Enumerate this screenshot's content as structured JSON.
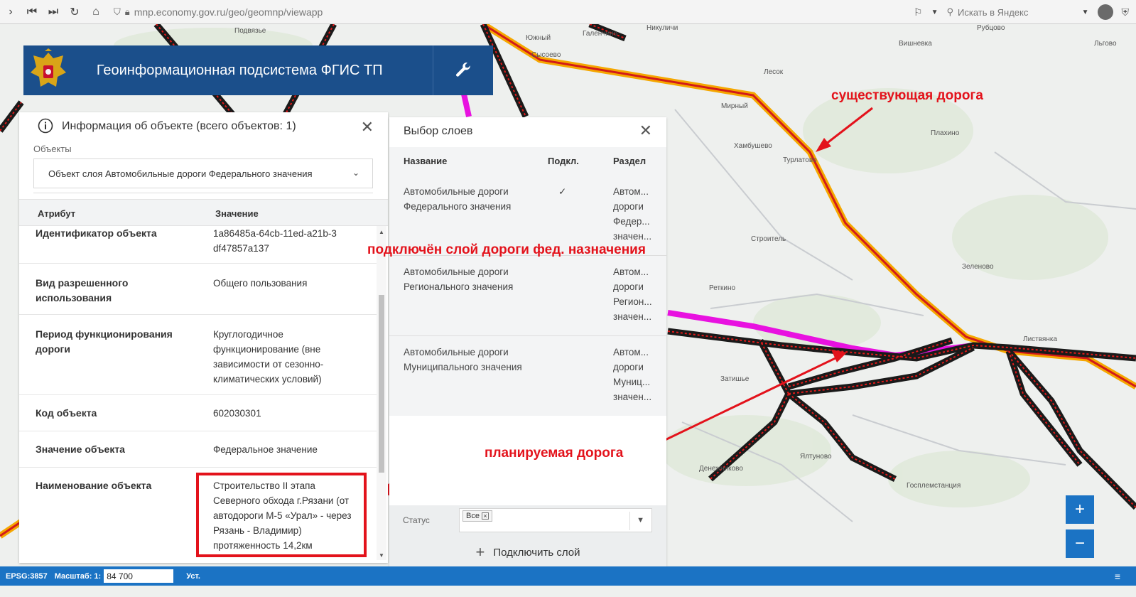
{
  "browser": {
    "url": "mnp.economy.gov.ru/geo/geomnp/viewapp",
    "search_placeholder": "Искать в Яндекс"
  },
  "header": {
    "title": "Геоинформационная подсистема ФГИС ТП"
  },
  "info_panel": {
    "title": "Информация об объекте (всего объектов: 1)",
    "objects_label": "Объекты",
    "selected_object": "Объект слоя Автомобильные дороги Федерального значения",
    "columns": [
      "Атрибут",
      "Значение"
    ],
    "rows": [
      {
        "attr": "Идентификатор объекта",
        "value": "1a86485a-64cb-11ed-a21b-3df47857a137"
      },
      {
        "attr": "Вид разрешенного использования",
        "value": "Общего пользования"
      },
      {
        "attr": "Период функционирования дороги",
        "value": "Круглогодичное функционирование (вне зависимости от сезонно-климатических условий)"
      },
      {
        "attr": "Код объекта",
        "value": "602030301"
      },
      {
        "attr": "Значение объекта",
        "value": "Федеральное значение"
      },
      {
        "attr": "Наименование объекта",
        "value": "Строительство II этапа Северного обхода г.Рязани (от автодороги М-5 «Урал» - через Рязань - Владимир) протяженность 14,2км"
      }
    ]
  },
  "layers_panel": {
    "title": "Выбор слоев",
    "columns": [
      "Название",
      "Подкл.",
      "Раздел"
    ],
    "rows": [
      {
        "name": "Автомобильные дороги Федерального значения",
        "connected": "✓",
        "section": "Автом... дороги Федер... значен..."
      },
      {
        "name": "Автомобильные дороги Регионального значения",
        "connected": "",
        "section": "Автом... дороги Регион... значен..."
      },
      {
        "name": "Автомобильные дороги Муниципального значения",
        "connected": "",
        "section": "Автом... дороги Муниц... значен..."
      }
    ],
    "status_label": "Статус",
    "status_tag": "Все",
    "add_layer_label": "Подключить слой"
  },
  "annotations": {
    "existing_road": "существующая дорога",
    "layer_connected": "подключён слой дороги фед. назначения",
    "planned_road": "планируемая дорога"
  },
  "map_labels": [
    "Подвязье",
    "Южный",
    "Галенчино",
    "Никуличи",
    "Сысоево",
    "Лесок",
    "Мирный",
    "Хамбушево",
    "Турлатово",
    "Плахино",
    "Строитель",
    "Реткино",
    "Зеленово",
    "Листвянка",
    "Ялтуново",
    "Затишье",
    "Денежниково",
    "Госплемстанция",
    "Рубцово",
    "Вишневка",
    "Льгово"
  ],
  "statusbar": {
    "epsg": "EPSG:3857",
    "scale_label": "Масштаб: 1:",
    "scale_value": "84 700",
    "set_label": "Уст.",
    "menu_icon": "≡"
  },
  "zoom": {
    "in": "+",
    "out": "−"
  },
  "colors": {
    "header_blue": "#1b4f8b",
    "accent_blue": "#1b73c4",
    "annotation_red": "#e3121b",
    "road_federal": "#f5a700",
    "road_planned": "#e812e0"
  }
}
